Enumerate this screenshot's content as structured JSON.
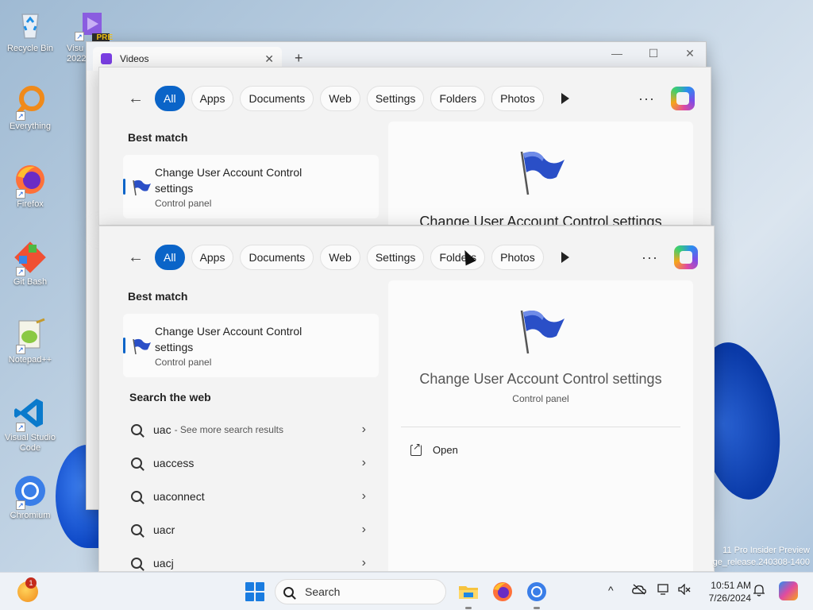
{
  "desktop": {
    "icons": [
      {
        "label": "Recycle Bin"
      },
      {
        "label": "Visual Studio 2022",
        "short": "Visu\n2022",
        "badge": "PRE"
      },
      {
        "label": "Everything"
      },
      {
        "label": "Firefox"
      },
      {
        "label": "Git Bash"
      },
      {
        "label": "Notepad++"
      },
      {
        "label": "Visual Studio Code"
      },
      {
        "label": "Chromium"
      }
    ],
    "watermark_line1": "11 Pro Insider Preview",
    "watermark_line2": "ge_release.240308-1400"
  },
  "back_window": {
    "tab_title": "Videos",
    "tab_close": "✕",
    "new_tab": "+",
    "minimize": "—",
    "maximize": "☐",
    "close": "✕"
  },
  "search": {
    "back": "←",
    "filters": [
      "All",
      "Apps",
      "Documents",
      "Web",
      "Settings",
      "Folders",
      "Photos"
    ],
    "more": "···",
    "best_match_label": "Best match",
    "best_match": {
      "title": "Change User Account Control settings",
      "subtitle": "Control panel"
    },
    "preview": {
      "title": "Change User Account Control settings",
      "subtitle": "Control panel",
      "open_label": "Open"
    },
    "web_label": "Search the web",
    "web_results": [
      {
        "term": "uac",
        "hint": "- See more search results"
      },
      {
        "term": "uaccess",
        "hint": ""
      },
      {
        "term": "uaconnect",
        "hint": ""
      },
      {
        "term": "uacr",
        "hint": ""
      },
      {
        "term": "uacj",
        "hint": ""
      }
    ],
    "chevron": "›"
  },
  "taskbar": {
    "weather_badge": "1",
    "search_placeholder": "Search",
    "time": "10:51 AM",
    "date": "7/26/2024",
    "tray_chevron": "^"
  },
  "colors": {
    "accent": "#0a64c8",
    "panel_bg": "#f3f3f3",
    "card_bg": "#fbfbfb"
  }
}
